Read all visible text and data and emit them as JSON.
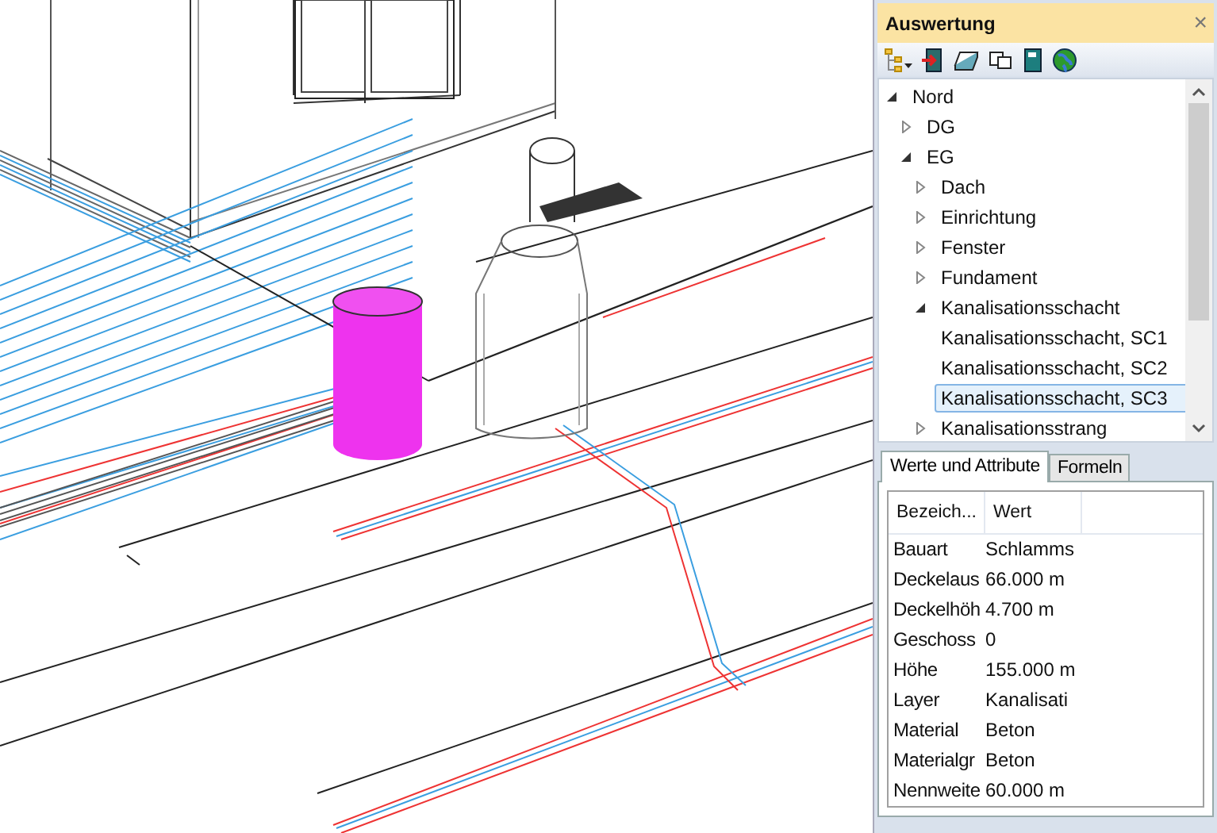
{
  "panel": {
    "title": "Auswertung",
    "close": "×"
  },
  "tree": [
    {
      "label": "Nord",
      "expanded": true,
      "children": [
        {
          "label": "DG",
          "expanded": false
        },
        {
          "label": "EG",
          "expanded": true,
          "children": [
            {
              "label": "Dach",
              "expanded": false
            },
            {
              "label": "Einrichtung",
              "expanded": false
            },
            {
              "label": "Fenster",
              "expanded": false
            },
            {
              "label": "Fundament",
              "expanded": false
            },
            {
              "label": "Kanalisationsschacht",
              "expanded": true,
              "children": [
                {
                  "label": "Kanalisationsschacht, SC1",
                  "selected": false
                },
                {
                  "label": "Kanalisationsschacht, SC2",
                  "selected": false
                },
                {
                  "label": "Kanalisationsschacht, SC3",
                  "selected": true
                }
              ]
            },
            {
              "label": "Kanalisationsstrang",
              "expanded": false
            }
          ]
        }
      ]
    }
  ],
  "tabs": [
    {
      "label": "Werte und Attribute",
      "selected": true
    },
    {
      "label": "Formeln",
      "selected": false
    }
  ],
  "table": {
    "columns": [
      "Bezeich...",
      "Wert"
    ],
    "rows": [
      [
        "Bauart",
        "Schlamms"
      ],
      [
        "Deckelaus",
        "66.000 m"
      ],
      [
        "Deckelhöh",
        "4.700 m"
      ],
      [
        "Geschoss",
        "0"
      ],
      [
        "Höhe",
        "155.000 m"
      ],
      [
        "Layer",
        "Kanalisati"
      ],
      [
        "Material",
        "Beton"
      ],
      [
        "Materialgr",
        "Beton"
      ],
      [
        "Nennweite",
        "60.000 m"
      ]
    ]
  }
}
